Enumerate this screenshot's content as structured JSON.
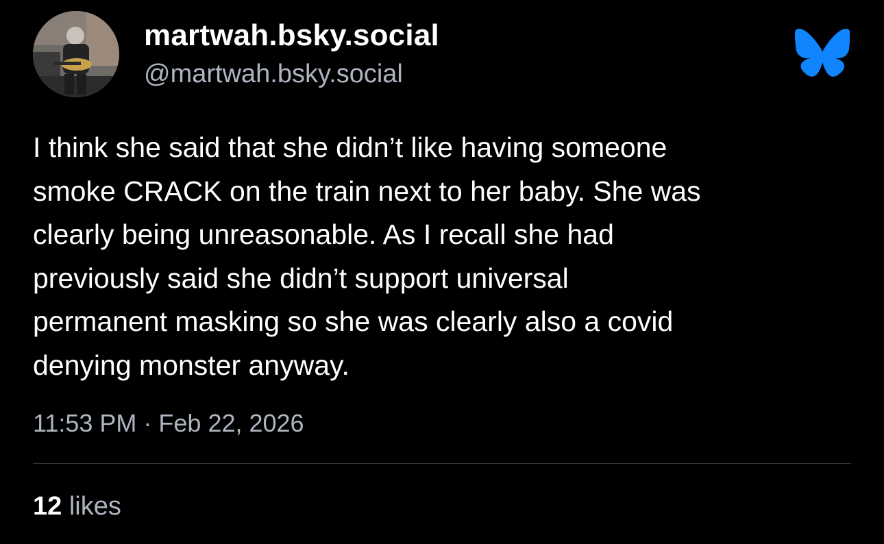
{
  "author": {
    "display_name": "martwah.bsky.social",
    "handle": "@martwah.bsky.social"
  },
  "post": {
    "lines": [
      "I think she said that she didn’t like having someone",
      "smoke CRACK on the train next to her baby. She was",
      "clearly being unreasonable. As I recall she had",
      "previously said she didn’t support universal",
      "permanent masking so she was clearly also a covid",
      "denying monster anyway."
    ],
    "timestamp": "11:53 PM · Feb 22, 2026"
  },
  "stats": {
    "likes_count": "12",
    "likes_label": "likes"
  },
  "icons": {
    "logo": "butterfly-icon",
    "avatar": "guitarist-photo"
  },
  "colors": {
    "background": "#000000",
    "text": "#ffffff",
    "secondary": "#aeb5c0",
    "accent": "#1185fe"
  }
}
